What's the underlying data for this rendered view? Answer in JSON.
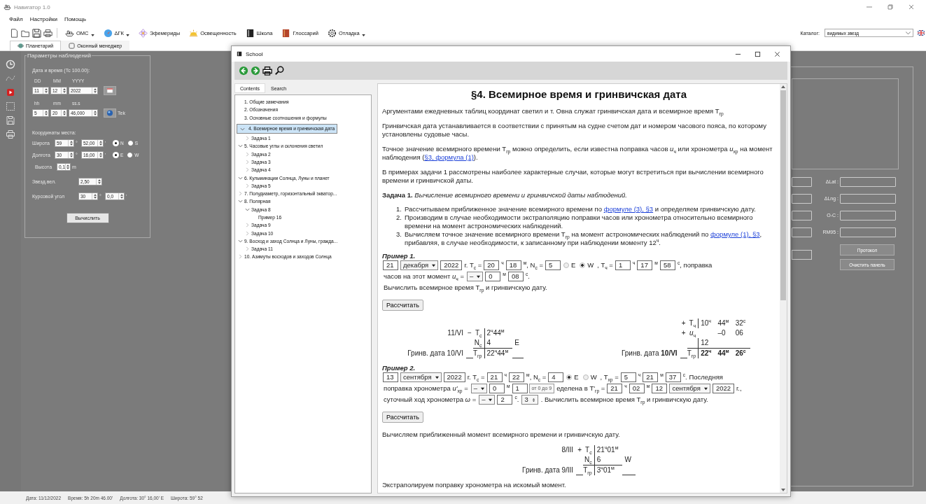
{
  "app": {
    "title": "Навигатор 1.0"
  },
  "menu": [
    "Файл",
    "Настройки",
    "Помощь"
  ],
  "toolbar": [
    {
      "label": "ОМС",
      "kind": "dropdown"
    },
    {
      "label": "ΔГК",
      "kind": "dropdown"
    },
    {
      "label": "Эфемериды",
      "kind": "button"
    },
    {
      "label": "Освещенность",
      "kind": "button"
    },
    {
      "label": "Школа",
      "kind": "button"
    },
    {
      "label": "Глоссарий",
      "kind": "button"
    },
    {
      "label": "Отладка",
      "kind": "dropdown"
    }
  ],
  "catalog": {
    "label": "Каталог:",
    "value": "видимых звезд"
  },
  "tabs": [
    {
      "label": "Планетарий",
      "selected": true
    },
    {
      "label": "Оконный менеджер",
      "selected": false
    }
  ],
  "observation_panel": {
    "title": "Параметры наблюдений",
    "datetime_label": "Дата и время (Tc  100.00):",
    "date_headers": [
      "DD",
      "MM",
      "YYYY"
    ],
    "date_values": [
      "11",
      "12",
      "2022"
    ],
    "time_headers": [
      "hh",
      "mm",
      "ss.s"
    ],
    "time_values": [
      "5",
      "20",
      "46,000"
    ],
    "now_label": "Tek",
    "coords_label": "Координаты места:",
    "coords": [
      {
        "label": "Широта",
        "degrees": "59",
        "deg_unit": "°",
        "minutes": "52,00",
        "min_unit": "'",
        "options": [
          {
            "label": "N",
            "selected": true
          },
          {
            "label": "S",
            "selected": false
          }
        ]
      },
      {
        "label": "Долгота",
        "degrees": "30",
        "deg_unit": "°",
        "minutes": "16,00",
        "min_unit": "'",
        "options": [
          {
            "label": "E",
            "selected": true
          },
          {
            "label": "W",
            "selected": false
          }
        ]
      }
    ],
    "height": {
      "label": "Высота",
      "value": "0,1",
      "unit": "m"
    },
    "magnitude": {
      "label": "Звезд.вел.",
      "value": "2,50"
    },
    "course": {
      "label": "Курсовой угол",
      "degrees": "30",
      "deg_unit": "°",
      "minutes": "0,0",
      "min_unit": "'"
    },
    "compute_button": "Вычислить"
  },
  "results_panel": {
    "fields": [
      {
        "label": "ΔLat :"
      },
      {
        "label": "ΔLng :"
      },
      {
        "label": "O-C :"
      },
      {
        "label": "RM95 :"
      }
    ],
    "buttons": [
      {
        "label": "Протокол",
        "disabled": true
      },
      {
        "label": "Очистить панель",
        "disabled": true
      }
    ]
  },
  "status_bar": [
    "Дата: 11/12/2022",
    "Время: 5h 20m 46.00'",
    "Долгота: 30° 16,00' E",
    "Широта: 59° 52"
  ],
  "school": {
    "title": "School",
    "tabs": [
      {
        "label": "Contents",
        "selected": true
      },
      {
        "label": "Search",
        "selected": false
      }
    ],
    "tree": [
      {
        "label": "1. Общие замечания",
        "selected": false
      },
      {
        "label": "2. Обозначения",
        "selected": false
      },
      {
        "label": "3. Основные соотношения и формулы",
        "selected": false
      },
      {
        "label": "4. Всемирное время и гринвичская дата",
        "selected": true,
        "expanded": true,
        "children": [
          {
            "label": "Задача 1",
            "selected": false,
            "expanded": false
          }
        ]
      },
      {
        "label": "5. Часовые углы и склонения светил",
        "selected": false,
        "expanded": true,
        "children": [
          {
            "label": "Задача 2",
            "selected": false,
            "expanded": false
          },
          {
            "label": "Задача 3",
            "selected": false,
            "expanded": false
          },
          {
            "label": "Задача 4",
            "selected": false,
            "expanded": false
          }
        ]
      },
      {
        "label": "6. Кульминации Солнца, Луны и планет",
        "selected": false,
        "expanded": true,
        "children": [
          {
            "label": "Задача 5",
            "selected": false,
            "expanded": false
          }
        ]
      },
      {
        "label": "7. Полудиаметр, горизонтальный экватор...",
        "selected": false,
        "expanded": false
      },
      {
        "label": "8. Полярная",
        "selected": false,
        "expanded": true,
        "children": [
          {
            "label": "Задача 8",
            "selected": false,
            "expanded": true,
            "children": [
              {
                "label": "Пример 16",
                "selected": false
              }
            ]
          },
          {
            "label": "Задача 9",
            "selected": false,
            "expanded": false
          },
          {
            "label": "Задача 10",
            "selected": false,
            "expanded": false
          }
        ]
      },
      {
        "label": "9. Восход и заход Солнца и Луны, гражда...",
        "selected": false,
        "expanded": true,
        "children": [
          {
            "label": "Задача 11",
            "selected": false,
            "expanded": false
          }
        ]
      },
      {
        "label": "10. Азимуты восходов и заходов Солнца",
        "selected": false,
        "expanded": false
      }
    ],
    "blocks": [
      {
        "kind": "heading",
        "text": "§4. Всемирное время и гринвичская дата"
      },
      {
        "kind": "paragraph",
        "parts": [
          {
            "kind": "text",
            "text": "Аргументами ежедневных таблиц координат светил и т. Овна служат гринвичская дата и всемирное время T$_{гр}$"
          }
        ]
      },
      {
        "kind": "paragraph",
        "parts": [
          {
            "kind": "text",
            "text": "Гринвичская дата устанавливается в соответствии с принятым на судне счетом дат и номером часового пояса, по которому установлены судовые часы."
          }
        ]
      },
      {
        "kind": "paragraph",
        "parts": [
          {
            "kind": "text",
            "text": "Точное значение всемирного времени T$_{гр}$ можно определить, если известна поправка часов *u*$_{ч}$ или хронометра *u*$_{хр}$ на момент наблюдения ("
          },
          {
            "kind": "link",
            "text": "§3, формула (1)"
          },
          {
            "kind": "text",
            "text": ")."
          }
        ]
      },
      {
        "kind": "paragraph",
        "parts": [
          {
            "kind": "text",
            "text": "В примерах задачи 1 рассмотрены наиболее характерные случаи, которые могут встретиться при вычислении всемирного времени и гринвичской даты."
          }
        ]
      },
      {
        "kind": "task",
        "text": "**Задача 1.** *Вычисление всемирного времени и гринвичской даты наблюдений.*"
      },
      {
        "kind": "list",
        "items": [
          {
            "number": "1.",
            "parts": [
              {
                "kind": "text",
                "text": "Рассчитываем приближенное значение всемирного времени по "
              },
              {
                "kind": "link",
                "text": "формуле (3), §3"
              },
              {
                "kind": "text",
                "text": " и определяем гринвичскую дату."
              }
            ]
          },
          {
            "number": "2.",
            "parts": [
              {
                "kind": "text",
                "text": "Производим в случае необходимости экстраполяцию поправки часов или хронометра относительно всемирного времени на момент астрономических наблюдений."
              }
            ]
          },
          {
            "number": "3.",
            "parts": [
              {
                "kind": "text",
                "text": "Вычисляем точное значение всемирного времени T$_{гр}$ на момент астрономических наблюдений по "
              },
              {
                "kind": "link",
                "text": "формуле (1), §3"
              },
              {
                "kind": "text",
                "text": ", прибавляя, в случае необходимости, к записанному при наблюдении моменту 12$^{ч}$."
              }
            ]
          }
        ]
      },
      {
        "kind": "example",
        "title": "Пример 1.",
        "lines": [
          [
            {
              "kind": "input",
              "value": "21"
            },
            {
              "kind": "select",
              "value": "декабря"
            },
            {
              "kind": "input",
              "value": "2022"
            },
            {
              "kind": "text",
              "text": "г. T$_{с}$ ="
            },
            {
              "kind": "input",
              "value": "20"
            },
            {
              "kind": "text",
              "text": "$^{ч}$"
            },
            {
              "kind": "input",
              "value": "18"
            },
            {
              "kind": "text",
              "text": "$^{м}$, N$_{с}$ ="
            },
            {
              "kind": "input",
              "value": "5"
            },
            {
              "kind": "radio",
              "label": "E",
              "selected": false
            },
            {
              "kind": "radio",
              "label": "W",
              "selected": true
            },
            {
              "kind": "text",
              "text": ", T$_{ч}$ ="
            },
            {
              "kind": "input",
              "value": "1"
            },
            {
              "kind": "text",
              "text": "$^{ч}$"
            },
            {
              "kind": "input",
              "value": "17"
            },
            {
              "kind": "text",
              "text": "$^{м}$"
            },
            {
              "kind": "input",
              "value": "58"
            },
            {
              "kind": "text",
              "text": "$^{с}$, поправка"
            }
          ],
          [
            {
              "kind": "text",
              "text": "часов на этот момент *u*$_{ч}$ ="
            },
            {
              "kind": "select",
              "value": "–"
            },
            {
              "kind": "input",
              "value": "0"
            },
            {
              "kind": "text",
              "text": "$^{м}$"
            },
            {
              "kind": "input",
              "value": "08"
            },
            {
              "kind": "text",
              "text": "$^{с}$."
            }
          ],
          [
            {
              "kind": "text",
              "text": "Вычислить всемирное время T$_{гр}$ и гринвичскую дату."
            }
          ]
        ]
      },
      {
        "kind": "button",
        "label": "Рассчитать"
      },
      {
        "kind": "calcs",
        "calcs": [
          {
            "rows": [
              {
                "label": "11/VI",
                "op": "−",
                "name": "T$_{с}$",
                "cells": [
                  "2$^{ч}$44$^{м}$",
                  null
                ]
              },
              {
                "name": "N$_{с}$",
                "cells": [
                  "4",
                  "E"
                ]
              },
              {
                "label": "Гринв. дата 10/VI",
                "name": "T$_{гр}$",
                "cells": [
                  "22$^{ч}$44$^{м}$",
                  null
                ],
                "total": true
              }
            ]
          },
          {
            "rows": [
              {
                "op": "+",
                "name": "T$_{ч}$",
                "cells": [
                  "10$^{ч}$",
                  "44$^{м}$",
                  "32$^{с}$"
                ]
              },
              {
                "op": "+",
                "name": "*u*$_{ч}$",
                "cells": [
                  null,
                  "–0",
                  "06"
                ]
              },
              {
                "cells": [
                  "12",
                  null,
                  null
                ]
              },
              {
                "label": "Гринв. дата **10/VI**",
                "name": "T$_{гр}$",
                "cells": [
                  "22$^{ч}$",
                  "44$^{м}$",
                  "26$^{с}$"
                ],
                "total": true,
                "bold": true
              }
            ]
          }
        ]
      },
      {
        "kind": "example",
        "title": "Пример 2.",
        "lines": [
          [
            {
              "kind": "input",
              "value": "13"
            },
            {
              "kind": "select",
              "value": "сентября"
            },
            {
              "kind": "input",
              "value": "2022"
            },
            {
              "kind": "text",
              "text": "г. T$_{с}$ ="
            },
            {
              "kind": "input",
              "value": "21"
            },
            {
              "kind": "text",
              "text": "$^{ч}$"
            },
            {
              "kind": "input",
              "value": "22"
            },
            {
              "kind": "text",
              "text": "$^{м}$, N$_{с}$ ="
            },
            {
              "kind": "input",
              "value": "4"
            },
            {
              "kind": "radio",
              "label": "E",
              "selected": true
            },
            {
              "kind": "radio",
              "label": "W",
              "selected": false
            },
            {
              "kind": "text",
              "text": ", T$_{хр}$ ="
            },
            {
              "kind": "input",
              "value": "5"
            },
            {
              "kind": "text",
              "text": "$^{ч}$"
            },
            {
              "kind": "input",
              "value": "21"
            },
            {
              "kind": "text",
              "text": "$^{м}$"
            },
            {
              "kind": "input",
              "value": "37"
            },
            {
              "kind": "text",
              "text": "$^{с}$. Последняя"
            }
          ],
          [
            {
              "kind": "text",
              "text": "поправка хронометра *u'*$_{хр}$ ="
            },
            {
              "kind": "select",
              "value": "–"
            },
            {
              "kind": "input",
              "value": "0"
            },
            {
              "kind": "text",
              "text": "$^{м}$"
            },
            {
              "kind": "input",
              "value": "1"
            },
            {
              "kind": "tooltip",
              "text": "от 0 до 9"
            },
            {
              "kind": "text",
              "text": "еделена в T'$_{гр}$ ="
            },
            {
              "kind": "input",
              "value": "21"
            },
            {
              "kind": "text",
              "text": "$^{ч}$"
            },
            {
              "kind": "input",
              "value": "02"
            },
            {
              "kind": "text",
              "text": "$^{м}$"
            },
            {
              "kind": "input",
              "value": "12"
            },
            {
              "kind": "select",
              "value": "сентября"
            },
            {
              "kind": "input",
              "value": "2022"
            },
            {
              "kind": "text",
              "text": "г.,"
            }
          ],
          [
            {
              "kind": "text",
              "text": "суточный ход хронометра *ω* ="
            },
            {
              "kind": "select",
              "value": "–"
            },
            {
              "kind": "input",
              "value": "2"
            },
            {
              "kind": "text",
              "text": "$^{с}$."
            },
            {
              "kind": "spin",
              "value": "3"
            },
            {
              "kind": "text",
              "text": ". Вычислить всемирное время T$_{гр}$ и гринвичскую дату."
            }
          ]
        ]
      },
      {
        "kind": "button",
        "label": "Рассчитать"
      },
      {
        "kind": "paragraph",
        "parts": [
          {
            "kind": "text",
            "text": "Вычисляем приближенный момент всемирного времени и гринвичскую дату."
          }
        ]
      },
      {
        "kind": "calcs",
        "calcs": [
          {
            "rows": [
              {
                "label": "8/III",
                "op": "+",
                "name": "T$_{с}$",
                "cells": [
                  "21$^{ч}$01$^{м}$",
                  null
                ]
              },
              {
                "name": "N$_{с}$",
                "cells": [
                  "6",
                  "W"
                ]
              },
              {
                "label": "Гринв. дата 9/III",
                "name": "T$_{гр}$",
                "cells": [
                  "3$^{ч}$01$^{м}$",
                  null
                ],
                "total": true
              }
            ]
          }
        ]
      },
      {
        "kind": "paragraph",
        "parts": [
          {
            "kind": "text",
            "text": "Экстраполируем поправку хронометра на искомый момент."
          }
        ]
      }
    ]
  }
}
